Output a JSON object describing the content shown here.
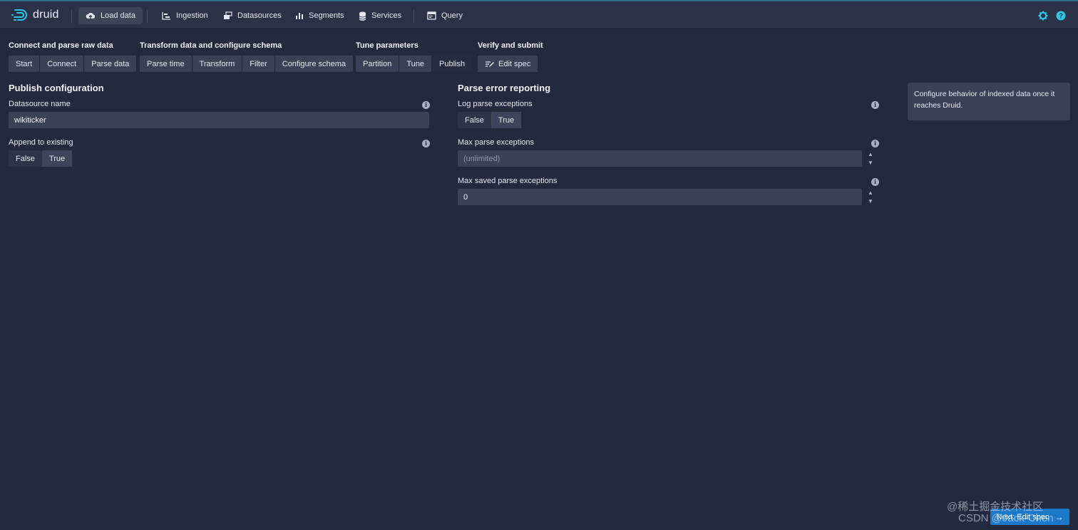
{
  "header": {
    "logo_text": "druid",
    "nav": [
      {
        "label": "Load data",
        "icon": "cloud-upload-icon",
        "active": true
      },
      {
        "label": "Ingestion",
        "icon": "gantt-chart-icon"
      },
      {
        "label": "Datasources",
        "icon": "multi-select-icon"
      },
      {
        "label": "Segments",
        "icon": "stacked-chart-icon"
      },
      {
        "label": "Services",
        "icon": "database-icon"
      },
      {
        "label": "Query",
        "icon": "application-icon"
      }
    ],
    "right_icons": [
      "gear-icon",
      "help-icon"
    ],
    "accent_color": "#2ec5e6"
  },
  "steps": {
    "groups": [
      {
        "title": "Connect and parse raw data",
        "buttons": [
          "Start",
          "Connect",
          "Parse data"
        ]
      },
      {
        "title": "Transform data and configure schema",
        "buttons": [
          "Parse time",
          "Transform",
          "Filter",
          "Configure schema"
        ]
      },
      {
        "title": "Tune parameters",
        "buttons": [
          "Partition",
          "Tune",
          "Publish"
        ]
      },
      {
        "title": "Verify and submit",
        "buttons": [
          "Edit spec"
        ]
      }
    ],
    "active": "Publish"
  },
  "publish": {
    "title": "Publish configuration",
    "datasource_label": "Datasource name",
    "datasource_value": "wikiticker",
    "append_label": "Append to existing",
    "append_options": [
      "False",
      "True"
    ],
    "append_selected": "True"
  },
  "parse_error": {
    "title": "Parse error reporting",
    "log_label": "Log parse exceptions",
    "log_options": [
      "False",
      "True"
    ],
    "log_selected": "True",
    "max_label": "Max parse exceptions",
    "max_placeholder": "(unlimited)",
    "saved_label": "Max saved parse exceptions",
    "saved_value": "0"
  },
  "callout": {
    "text": "Configure behavior of indexed data once it reaches Druid."
  },
  "footer": {
    "next_label": "Next: Edit spec",
    "next_color": "#1c78c9"
  },
  "watermarks": {
    "line1": "@稀土掘金技术社区",
    "line2": "CSDN @Jack-Chen"
  }
}
